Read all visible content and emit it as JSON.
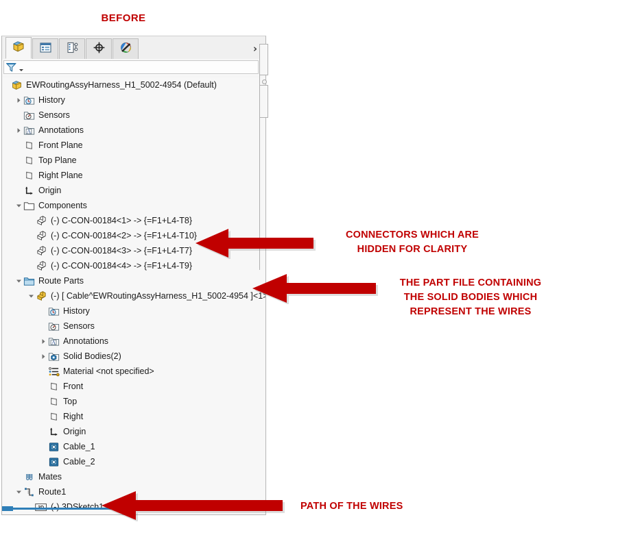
{
  "caption": {
    "before_label": "BEFORE"
  },
  "panel": {
    "tabs": [
      {
        "name": "feature-manager-design-tree-tab",
        "icon": "assembly-cube-icon",
        "active": true
      },
      {
        "name": "property-manager-tab",
        "icon": "property-list-icon",
        "active": false
      },
      {
        "name": "configuration-manager-tab",
        "icon": "configuration-icon",
        "active": false
      },
      {
        "name": "dimxpert-manager-tab",
        "icon": "crosshair-target-icon",
        "active": false
      },
      {
        "name": "display-manager-tab",
        "icon": "appearance-sphere-icon",
        "active": false
      }
    ],
    "overflow_label": "›",
    "filter": {
      "icon": "filter-funnel-icon",
      "dropdown_icon": "chevron-down-icon",
      "placeholder": "",
      "value": ""
    }
  },
  "tree": {
    "items": [
      {
        "label": "EWRoutingAssyHarness_H1_5002-4954  (Default)",
        "icon": "assembly-cube-icon",
        "indent": 0,
        "twist": "none"
      },
      {
        "label": "History",
        "icon": "history-folder-icon",
        "indent": 1,
        "twist": "collapsed"
      },
      {
        "label": "Sensors",
        "icon": "sensors-folder-icon",
        "indent": 1,
        "twist": "none"
      },
      {
        "label": "Annotations",
        "icon": "annotations-folder-icon",
        "indent": 1,
        "twist": "collapsed"
      },
      {
        "label": "Front Plane",
        "icon": "plane-icon",
        "indent": 1,
        "twist": "none"
      },
      {
        "label": "Top Plane",
        "icon": "plane-icon",
        "indent": 1,
        "twist": "none"
      },
      {
        "label": "Right Plane",
        "icon": "plane-icon",
        "indent": 1,
        "twist": "none"
      },
      {
        "label": "Origin",
        "icon": "origin-axis-icon",
        "indent": 1,
        "twist": "none"
      },
      {
        "label": "Components",
        "icon": "folder-icon",
        "indent": 1,
        "twist": "expanded"
      },
      {
        "label": "(-) C-CON-00184<1>  ->  {=F1+L4-T8}",
        "icon": "component-part-icon",
        "indent": 2,
        "twist": "none"
      },
      {
        "label": "(-) C-CON-00184<2>  ->  {=F1+L4-T10}",
        "icon": "component-part-icon",
        "indent": 2,
        "twist": "none"
      },
      {
        "label": "(-) C-CON-00184<3>  ->  {=F1+L4-T7}",
        "icon": "component-part-icon",
        "indent": 2,
        "twist": "none"
      },
      {
        "label": "(-) C-CON-00184<4>  ->  {=F1+L4-T9}",
        "icon": "component-part-icon",
        "indent": 2,
        "twist": "none"
      },
      {
        "label": "Route Parts",
        "icon": "folder-blue-icon",
        "indent": 1,
        "twist": "expanded"
      },
      {
        "label": "(-) [ Cable^EWRoutingAssyHarness_H1_5002-4954 ]<1>",
        "icon": "part-yellow-icon",
        "indent": 2,
        "twist": "expanded"
      },
      {
        "label": "History",
        "icon": "history-folder-icon",
        "indent": 3,
        "twist": "none"
      },
      {
        "label": "Sensors",
        "icon": "sensors-folder-icon",
        "indent": 3,
        "twist": "none"
      },
      {
        "label": "Annotations",
        "icon": "annotations-folder-icon",
        "indent": 3,
        "twist": "collapsed"
      },
      {
        "label": "Solid Bodies(2)",
        "icon": "solid-bodies-folder-icon",
        "indent": 3,
        "twist": "collapsed"
      },
      {
        "label": "Material <not specified>",
        "icon": "material-icon",
        "indent": 3,
        "twist": "none"
      },
      {
        "label": "Front",
        "icon": "plane-icon",
        "indent": 3,
        "twist": "none"
      },
      {
        "label": "Top",
        "icon": "plane-icon",
        "indent": 3,
        "twist": "none"
      },
      {
        "label": "Right",
        "icon": "plane-icon",
        "indent": 3,
        "twist": "none"
      },
      {
        "label": "Origin",
        "icon": "origin-axis-icon",
        "indent": 3,
        "twist": "none"
      },
      {
        "label": "Cable_1",
        "icon": "cable-feature-icon",
        "indent": 3,
        "twist": "none"
      },
      {
        "label": "Cable_2",
        "icon": "cable-feature-icon",
        "indent": 3,
        "twist": "none"
      },
      {
        "label": "Mates",
        "icon": "mates-paperclip-icon",
        "indent": 1,
        "twist": "none"
      },
      {
        "label": "Route1",
        "icon": "route-icon",
        "indent": 1,
        "twist": "expanded"
      },
      {
        "label": "(-) 3DSketch1",
        "icon": "sketch-3d-icon",
        "indent": 2,
        "twist": "none"
      }
    ]
  },
  "annotations": [
    {
      "name": "note-connectors-hidden",
      "text": "CONNECTORS WHICH ARE\nHIDDEN FOR CLARITY",
      "color": "#C00000"
    },
    {
      "name": "note-part-file-solid-bodies",
      "text": "THE PART FILE CONTAINING\nTHE SOLID BODIES WHICH\nREPRESENT THE WIRES",
      "color": "#C00000"
    },
    {
      "name": "note-path-of-wires",
      "text": "PATH OF THE WIRES",
      "color": "#C00000"
    }
  ],
  "arrows": [
    {
      "name": "arrow-to-connectors",
      "direction": "left",
      "color": "#C00000"
    },
    {
      "name": "arrow-to-cable-part",
      "direction": "left",
      "color": "#C00000"
    },
    {
      "name": "arrow-to-3dsketch",
      "direction": "left",
      "color": "#C00000"
    }
  ]
}
